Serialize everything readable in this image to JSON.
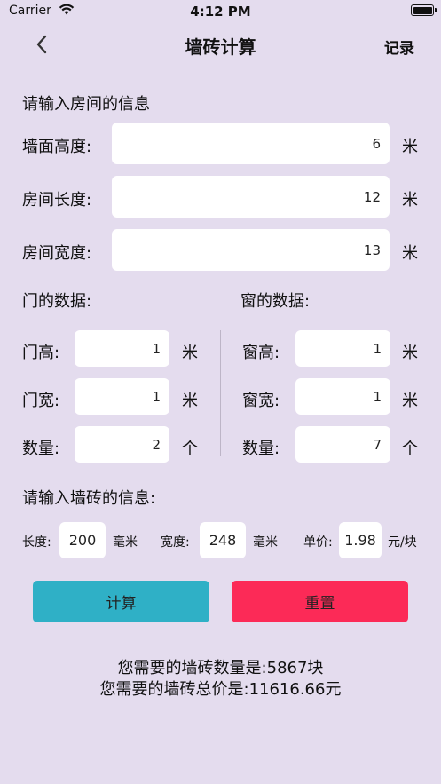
{
  "status_bar": {
    "carrier": "Carrier",
    "time": "4:12 PM"
  },
  "nav": {
    "title": "墙砖计算",
    "record_label": "记录"
  },
  "room": {
    "section_title": "请输入房间的信息",
    "fields": [
      {
        "label": "墙面高度:",
        "value": "6",
        "unit": "米"
      },
      {
        "label": "房间长度:",
        "value": "12",
        "unit": "米"
      },
      {
        "label": "房间宽度:",
        "value": "13",
        "unit": "米"
      }
    ]
  },
  "door": {
    "section_title": "门的数据:",
    "fields": [
      {
        "label": "门高:",
        "value": "1",
        "unit": "米"
      },
      {
        "label": "门宽:",
        "value": "1",
        "unit": "米"
      },
      {
        "label": "数量:",
        "value": "2",
        "unit": "个"
      }
    ]
  },
  "window": {
    "section_title": "窗的数据:",
    "fields": [
      {
        "label": "窗高:",
        "value": "1",
        "unit": "米"
      },
      {
        "label": "窗宽:",
        "value": "1",
        "unit": "米"
      },
      {
        "label": "数量:",
        "value": "7",
        "unit": "个"
      }
    ]
  },
  "tile": {
    "section_title": "请输入墙砖的信息:",
    "length": {
      "label": "长度:",
      "value": "200",
      "unit": "毫米"
    },
    "width": {
      "label": "宽度:",
      "value": "248",
      "unit": "毫米"
    },
    "price": {
      "label": "单价:",
      "value": "1.98",
      "unit": "元/块"
    }
  },
  "buttons": {
    "calculate": "计算",
    "reset": "重置"
  },
  "colors": {
    "background": "#e4dcee",
    "calculate": "#2fb0c6",
    "reset": "#fc2a57"
  },
  "result": {
    "count_text": "您需要的墙砖数量是:5867块",
    "price_text": "您需要的墙砖总价是:11616.66元"
  }
}
